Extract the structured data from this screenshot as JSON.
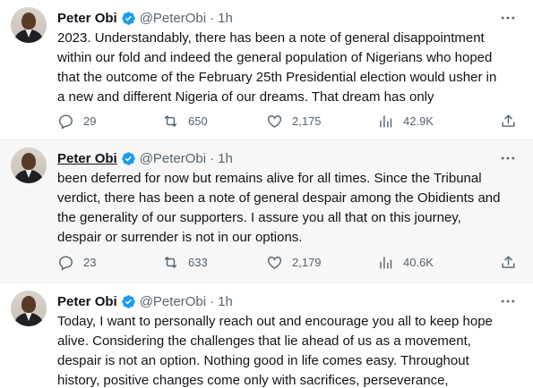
{
  "tweets": [
    {
      "name": "Peter Obi",
      "handle": "@PeterObi",
      "separator": "·",
      "time": "1h",
      "text": "2023. Understandably, there has been a note of general disappointment\nwithin our fold and indeed the general population of Nigerians who hoped\nthat the outcome of the February 25th Presidential election would usher in\na new and different Nigeria of our dreams. That dream has only",
      "replies": "29",
      "retweets": "650",
      "likes": "2,175",
      "views": "42.9K"
    },
    {
      "name": "Peter Obi",
      "handle": "@PeterObi",
      "separator": "·",
      "time": "1h",
      "text": "been deferred for now but remains alive for all times. Since the Tribunal\nverdict, there has been a note of general despair among the Obidients and\nthe generality of our supporters. I assure you all that on this journey,\ndespair or surrender is not in our options.",
      "replies": "23",
      "retweets": "633",
      "likes": "2,179",
      "views": "40.6K"
    },
    {
      "name": "Peter Obi",
      "handle": "@PeterObi",
      "separator": "·",
      "time": "1h",
      "text": "Today, I want to personally reach out and encourage you all to keep hope\nalive. Considering the challenges that lie ahead of us as a movement,\ndespair is not an option. Nothing good in life comes easy. Throughout\nhistory, positive changes come only with sacrifices, perseverance,",
      "replies": "",
      "retweets": "",
      "likes": "",
      "views": ""
    }
  ],
  "icons": {
    "verified": "verified-badge-icon",
    "more": "more-dots-icon",
    "reply": "reply-icon",
    "retweet": "retweet-icon",
    "like": "heart-icon",
    "views": "views-icon",
    "share": "share-icon"
  },
  "colors": {
    "verified": "#1d9bf0",
    "secondary_text": "#536471",
    "primary_text": "#0f1419",
    "divider": "#eff3f4",
    "hover_background": "#f7f7f7"
  }
}
